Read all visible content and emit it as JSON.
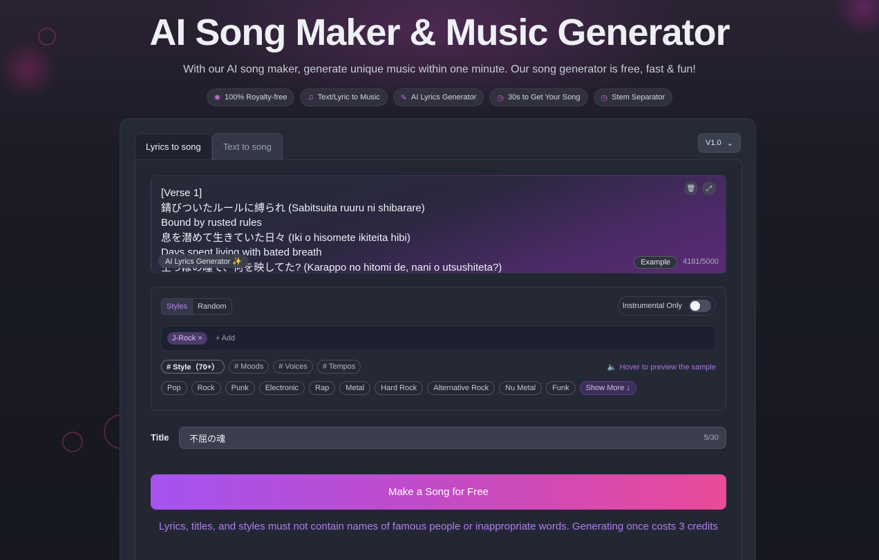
{
  "header": {
    "title": "AI Song Maker & Music Generator",
    "subtitle": "With our AI song maker, generate unique music within one minute. Our song generator is free, fast & fun!"
  },
  "badges": [
    {
      "icon": "sparkle-icon",
      "label": "100% Royalty-free"
    },
    {
      "icon": "music-note-icon",
      "label": "Text/Lyric to Music"
    },
    {
      "icon": "pen-icon",
      "label": "AI Lyrics Generator"
    },
    {
      "icon": "stopwatch-icon",
      "label": "30s to Get Your Song"
    },
    {
      "icon": "stopwatch-icon",
      "label": "Stem Separator"
    }
  ],
  "tabs": [
    {
      "label": "Lyrics to song",
      "active": true
    },
    {
      "label": "Text to song",
      "active": false
    }
  ],
  "version": {
    "label": "V1.0"
  },
  "lyrics": {
    "text": "[Verse 1]\n錆びついたルールに縛られ (Sabitsuita ruuru ni shibarare)\nBound by rusted rules\n息を潜めて生きていた日々 (Iki o hisomete ikiteita hibi)\nDays spent living with bated breath\n空っぽの瞳で、何を映してた? (Karappo no hitomi de, nani o utsushiteta?)",
    "ai_generator_label": "AI Lyrics Generator ✨",
    "example_label": "Example",
    "char_count": "4181/5000"
  },
  "styles": {
    "mode_styles": "Styles",
    "mode_random": "Random",
    "instrumental_label": "Instrumental Only",
    "instrumental_on": false,
    "selected_tags": [
      "J-Rock ×"
    ],
    "add_placeholder": "+ Add",
    "categories": [
      "# Style（70+）",
      "# Moods",
      "# Voices",
      "# Tempos"
    ],
    "hover_hint": "Hover to preview the sample",
    "chips": [
      "Pop",
      "Rock",
      "Punk",
      "Electronic",
      "Rap",
      "Metal",
      "Hard Rock",
      "Alternative Rock",
      "Nu Metal",
      "Funk"
    ],
    "show_more": "Show More ↓"
  },
  "title_field": {
    "label": "Title",
    "value": "不屈の魂",
    "count": "5/30"
  },
  "make_button": "Make a Song for Free",
  "notice": "Lyrics, titles, and styles must not contain names of famous people or inappropriate words. Generating once costs 3 credits",
  "colors": {
    "accent": "#b27ef0",
    "button_start": "#a553f1",
    "button_end": "#ea4a98"
  }
}
